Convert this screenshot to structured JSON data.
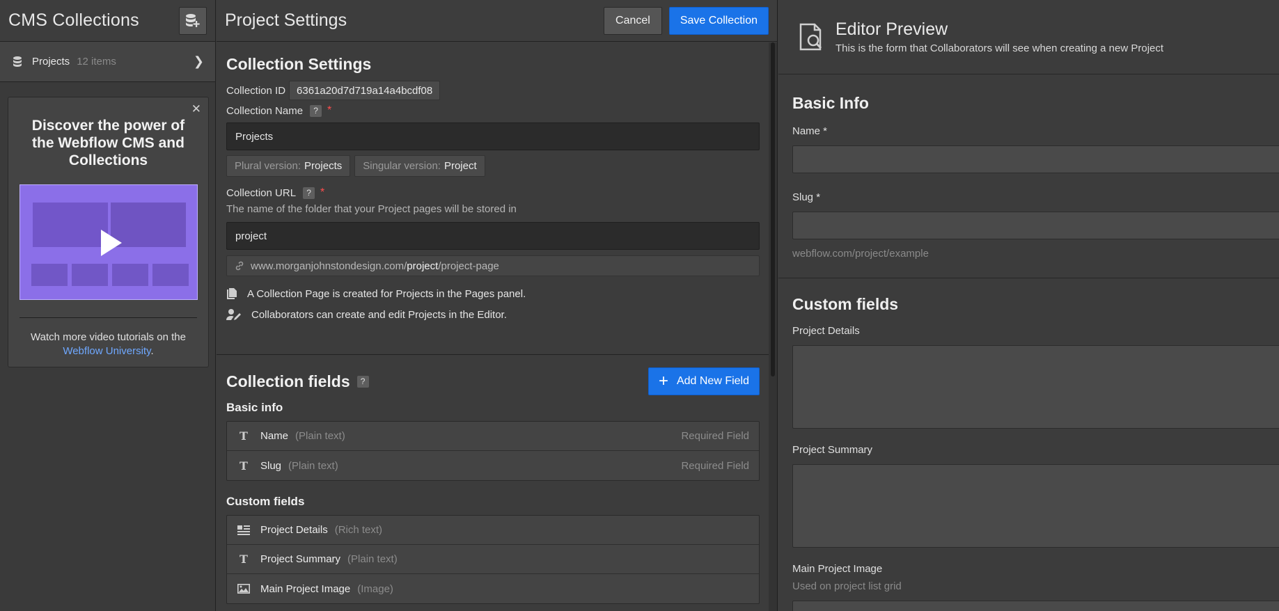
{
  "sidebar": {
    "title": "CMS Collections",
    "collection": {
      "name": "Projects",
      "count": "12 items"
    },
    "promo": {
      "title": "Discover the power of the Webflow CMS and Collections",
      "footer_text": "Watch more video tutorials on the",
      "link_text": "Webflow University",
      "footer_end": "."
    }
  },
  "header": {
    "title": "Project Settings",
    "cancel_label": "Cancel",
    "save_label": "Save Collection"
  },
  "settings": {
    "heading": "Collection Settings",
    "id_label": "Collection ID",
    "id_value": "6361a20d7d719a14a4bcdf08",
    "name_label": "Collection Name",
    "name_value": "Projects",
    "plural_label": "Plural version:",
    "plural_value": "Projects",
    "singular_label": "Singular version:",
    "singular_value": "Project",
    "url_label": "Collection URL",
    "url_hint": "The name of the folder that your Project pages will be stored in",
    "url_value": "project",
    "url_prefix": "www.morganjohnstondesign.com/",
    "url_slug": "project",
    "url_suffix": "/project-page",
    "info1": "A Collection Page is created for Projects in the Pages panel.",
    "info2": "Collaborators can create and edit Projects in the Editor."
  },
  "fields": {
    "heading": "Collection fields",
    "add_label": "Add New Field",
    "basic_heading": "Basic info",
    "basic": [
      {
        "name": "Name",
        "type": "(Plain text)",
        "req": "Required Field"
      },
      {
        "name": "Slug",
        "type": "(Plain text)",
        "req": "Required Field"
      }
    ],
    "custom_heading": "Custom fields",
    "custom": [
      {
        "name": "Project Details",
        "type": "(Rich text)"
      },
      {
        "name": "Project Summary",
        "type": "(Plain text)"
      },
      {
        "name": "Main Project Image",
        "type": "(Image)"
      }
    ]
  },
  "preview": {
    "title": "Editor Preview",
    "subtitle": "This is the form that Collaborators will see when creating a new Project",
    "basic_heading": "Basic Info",
    "name_label": "Name *",
    "slug_label": "Slug *",
    "slug_hint": "webflow.com/project/example",
    "custom_heading": "Custom fields",
    "details_label": "Project Details",
    "summary_label": "Project Summary",
    "image_label": "Main Project Image",
    "image_hint": "Used on project list grid"
  }
}
